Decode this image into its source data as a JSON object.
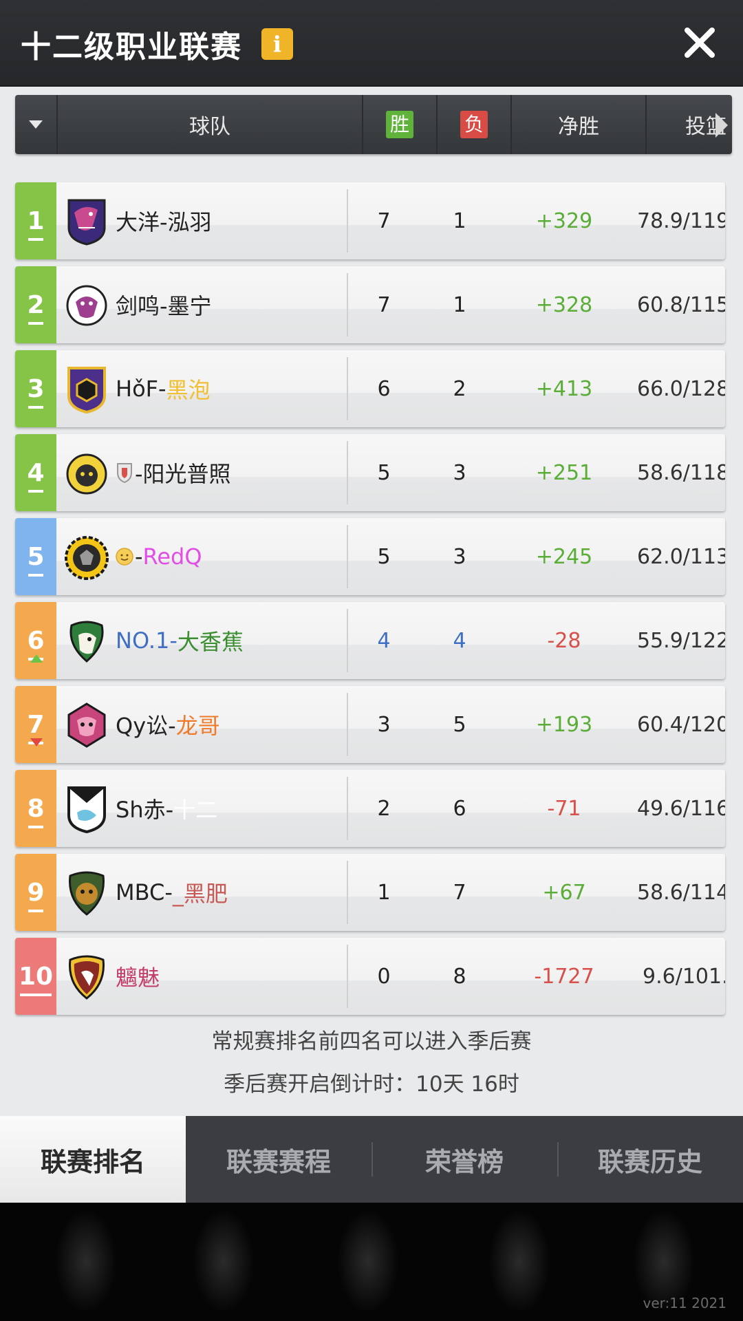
{
  "header": {
    "title": "十二级职业联赛",
    "info_label": "i",
    "close_icon": "close-icon"
  },
  "columns": {
    "team": "球队",
    "win": "胜",
    "loss": "负",
    "net": "净胜",
    "shot": "投篮"
  },
  "teams": [
    {
      "rank": "1",
      "name_a": "大洋-泓羽",
      "name_b": "",
      "wins": "7",
      "losses": "1",
      "net": "+329",
      "shot": "78.9/119"
    },
    {
      "rank": "2",
      "name_a": "剑鸣-墨宁",
      "name_b": "",
      "wins": "7",
      "losses": "1",
      "net": "+328",
      "shot": "60.8/115"
    },
    {
      "rank": "3",
      "name_a": "HǒF-",
      "name_b": "黑泡",
      "wins": "6",
      "losses": "2",
      "net": "+413",
      "shot": "66.0/128"
    },
    {
      "rank": "4",
      "name_a": "-阳光普照",
      "name_b": "",
      "wins": "5",
      "losses": "3",
      "net": "+251",
      "shot": "58.6/118"
    },
    {
      "rank": "5",
      "name_a": "-",
      "name_b": "RedQ",
      "wins": "5",
      "losses": "3",
      "net": "+245",
      "shot": "62.0/113"
    },
    {
      "rank": "6",
      "name_a": "NO.1-",
      "name_b": "大香蕉",
      "wins": "4",
      "losses": "4",
      "net": "-28",
      "shot": "55.9/122"
    },
    {
      "rank": "7",
      "name_a": "Qy讼-",
      "name_b": "龙哥",
      "wins": "3",
      "losses": "5",
      "net": "+193",
      "shot": "60.4/120"
    },
    {
      "rank": "8",
      "name_a": "Sh赤-",
      "name_b": "十二",
      "wins": "2",
      "losses": "6",
      "net": "-71",
      "shot": "49.6/116"
    },
    {
      "rank": "9",
      "name_a": "MBC-",
      "name_b": "_黑肥",
      "wins": "1",
      "losses": "7",
      "net": "+67",
      "shot": "58.6/114"
    },
    {
      "rank": "10",
      "name_a": "魑魅",
      "name_b": "",
      "wins": "0",
      "losses": "8",
      "net": "-1727",
      "shot": "9.6/101."
    }
  ],
  "notes": {
    "line1": "常规赛排名前四名可以进入季后赛",
    "line2": "季后赛开启倒计时：10天 16时"
  },
  "tabs": [
    "联赛排名",
    "联赛赛程",
    "荣誉榜",
    "联赛历史"
  ],
  "version": "ver:11  2021",
  "colors": {
    "win_badge": "#5fb33a",
    "loss_badge": "#d94b45",
    "positive": "#5aad36",
    "negative": "#d9504a",
    "playoff_rank": "#85c446",
    "mid_rank_blue": "#7fb4ee",
    "mid_rank_orange": "#f4a94f",
    "last_rank": "#ec7a79"
  }
}
